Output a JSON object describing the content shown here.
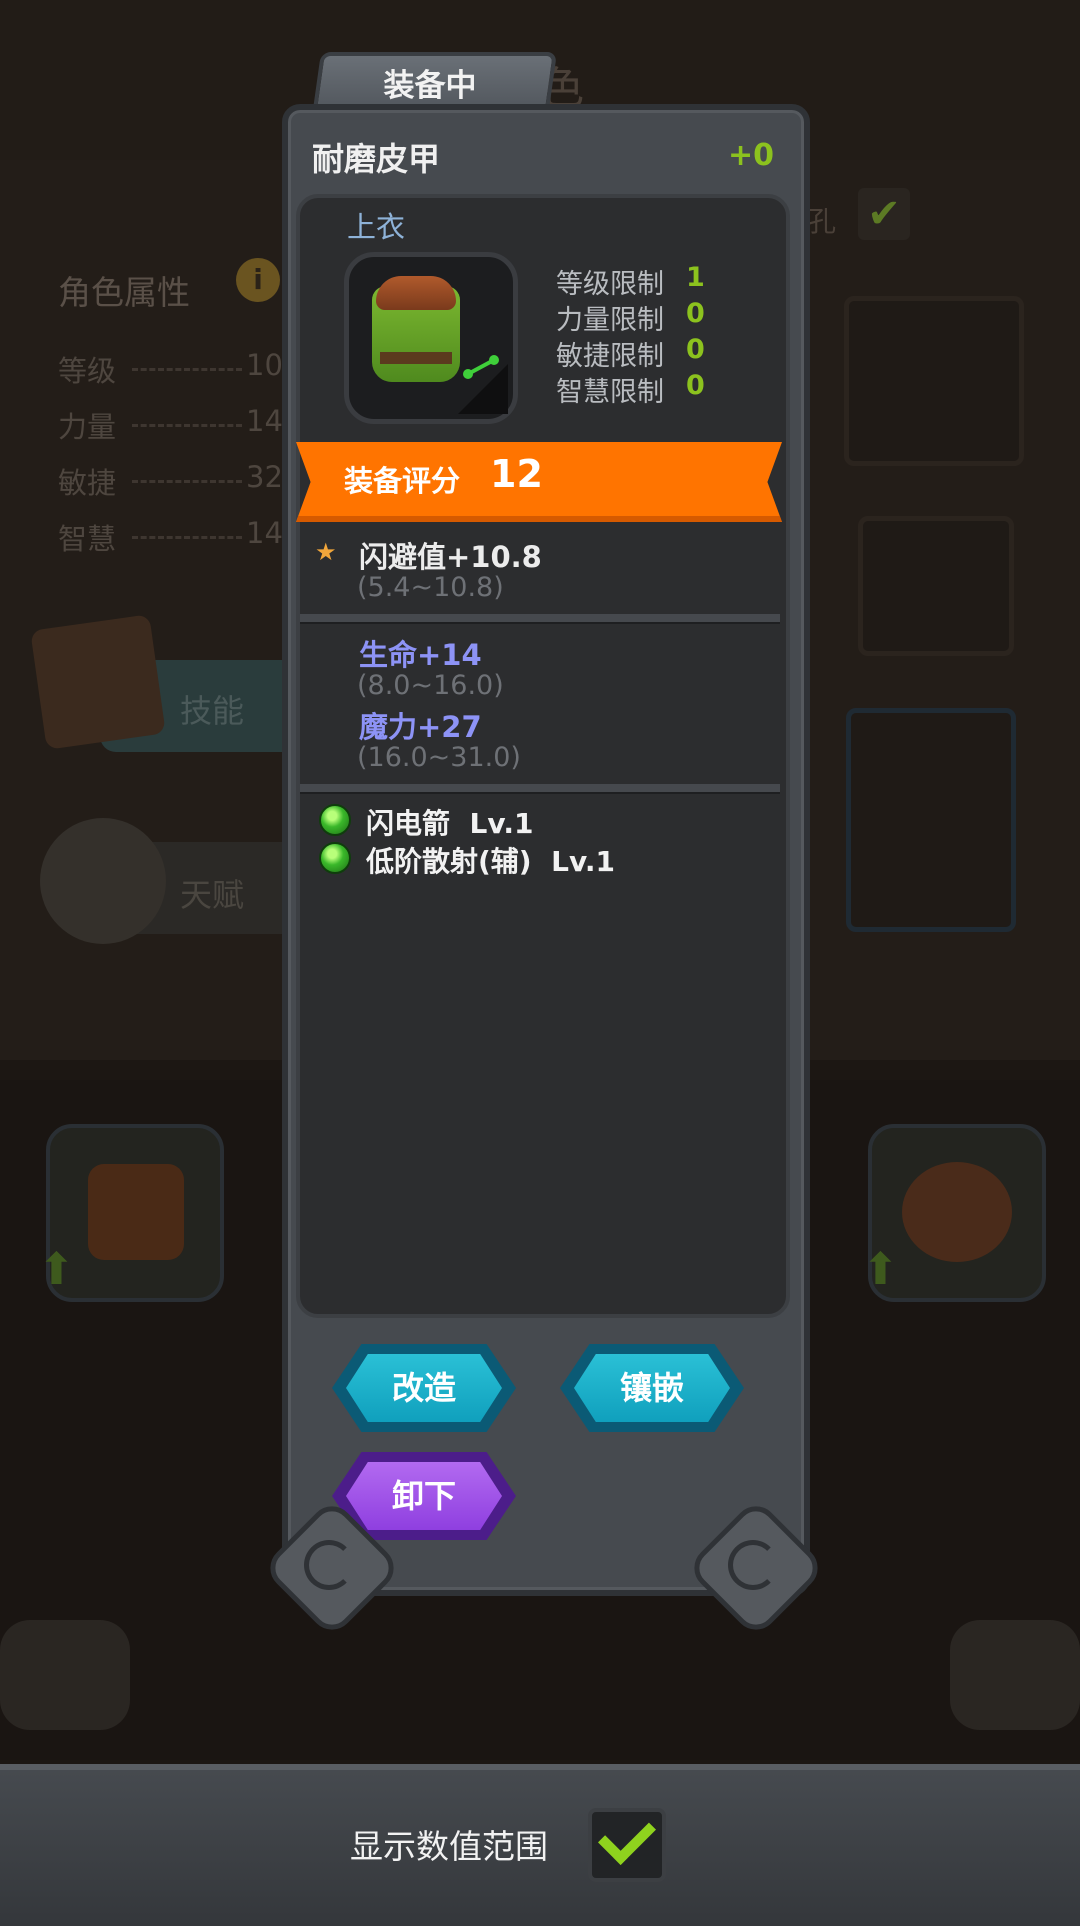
{
  "background": {
    "title_partial": "色",
    "attr_title": "角色属性",
    "info_icon": "i",
    "stats": [
      {
        "label": "等级",
        "value": "10"
      },
      {
        "label": "力量",
        "value": "14"
      },
      {
        "label": "敏捷",
        "value": "32"
      },
      {
        "label": "智慧",
        "value": "14"
      }
    ],
    "skill_button": "技能",
    "talent_button": "天赋",
    "socket_text_partial": "孔"
  },
  "tab": {
    "label": "装备中"
  },
  "item": {
    "name": "耐磨皮甲",
    "plus": "+0",
    "slot_type": "上衣",
    "requirements": [
      {
        "label": "等级限制",
        "value": "1"
      },
      {
        "label": "力量限制",
        "value": "0"
      },
      {
        "label": "敏捷限制",
        "value": "0"
      },
      {
        "label": "智慧限制",
        "value": "0"
      }
    ],
    "score_label": "装备评分",
    "score_value": "12",
    "main_stat": {
      "text": "闪避值+10.8",
      "range": "(5.4~10.8)"
    },
    "extra_stats": [
      {
        "text": "生命+14",
        "range": "(8.0~16.0)"
      },
      {
        "text": "魔力+27",
        "range": "(16.0~31.0)"
      }
    ],
    "skills": [
      {
        "name": "闪电箭",
        "level": "Lv.1"
      },
      {
        "name": "低阶散射(辅)",
        "level": "Lv.1"
      }
    ]
  },
  "buttons": {
    "reforge": "改造",
    "inlay": "镶嵌",
    "unequip": "卸下"
  },
  "bottom": {
    "show_range_label": "显示数值范围",
    "show_range_checked": true
  },
  "colors": {
    "score_banner": "#ff7400",
    "requirement_value": "#8cc21e",
    "bonus_stat": "#8d93f6",
    "slot_type": "#8eb2d8",
    "button_teal": "#1aaecb",
    "button_purple": "#9b4ce6"
  }
}
